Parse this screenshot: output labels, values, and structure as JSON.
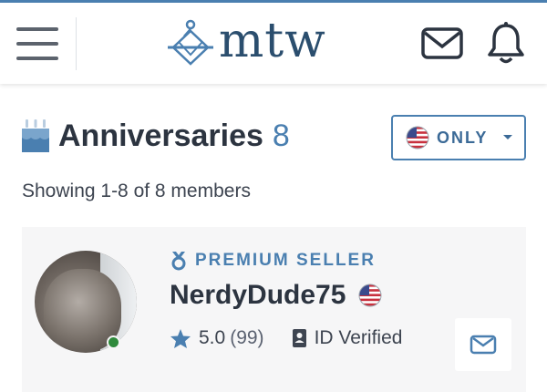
{
  "header": {
    "logo_text": "mtw",
    "menu_icon": "hamburger-menu-icon",
    "mail_icon": "envelope-icon",
    "notifications_icon": "bell-icon"
  },
  "page": {
    "heading_icon": "birthday-cake-icon",
    "heading_title": "Anniversaries",
    "heading_count": "8",
    "filter": {
      "label": "ONLY",
      "flag_icon": "us-flag-icon",
      "caret_icon": "caret-down-icon"
    },
    "showing_text": "Showing 1-8 of 8 members"
  },
  "members": [
    {
      "badge_icon": "medal-icon",
      "badge_label": "PREMIUM SELLER",
      "username": "NerdyDude75",
      "flag_icon": "us-flag-icon",
      "online": true,
      "rating": "5.0",
      "rating_count": "(99)",
      "verified_label": "ID Verified",
      "message_icon": "message-icon"
    }
  ],
  "colors": {
    "brand_blue": "#4a7fb0",
    "logo_navy": "#2b4e6e",
    "text_dark": "#2c3440",
    "online_green": "#2f8a3c",
    "card_bg": "#f6f6f7"
  }
}
